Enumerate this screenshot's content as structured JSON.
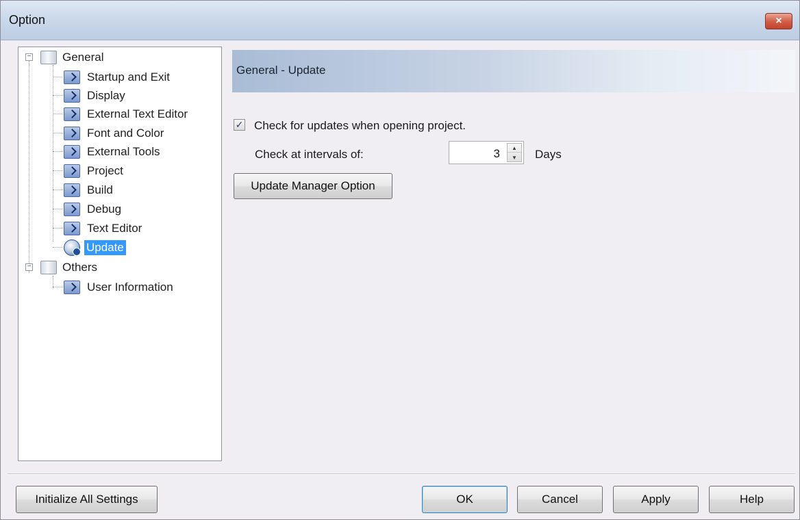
{
  "window": {
    "title": "Option",
    "close_glyph": "×"
  },
  "tree": {
    "groups": [
      {
        "label": "General",
        "expander": "−",
        "items": [
          {
            "label": "Startup and Exit"
          },
          {
            "label": "Display"
          },
          {
            "label": "External Text Editor"
          },
          {
            "label": "Font and Color"
          },
          {
            "label": "External Tools"
          },
          {
            "label": "Project"
          },
          {
            "label": "Build"
          },
          {
            "label": "Debug"
          },
          {
            "label": "Text Editor"
          },
          {
            "label": "Update",
            "selected": true
          }
        ]
      },
      {
        "label": "Others",
        "expander": "−",
        "items": [
          {
            "label": "User Information"
          }
        ]
      }
    ]
  },
  "panel": {
    "header": "General - Update",
    "check_updates": {
      "label": "Check for updates when opening project.",
      "checked": true,
      "glyph": "✓"
    },
    "interval": {
      "label": "Check at intervals of:",
      "value": "3",
      "unit": "Days",
      "up_glyph": "▲",
      "down_glyph": "▼"
    },
    "update_manager_button": "Update Manager Option"
  },
  "footer": {
    "initialize_button": "Initialize All Settings",
    "ok_button": "OK",
    "cancel_button": "Cancel",
    "apply_button": "Apply",
    "help_button": "Help"
  },
  "colors": {
    "selection": "#3399ff",
    "accent": "#3c7fb1",
    "close": "#c2412c"
  }
}
